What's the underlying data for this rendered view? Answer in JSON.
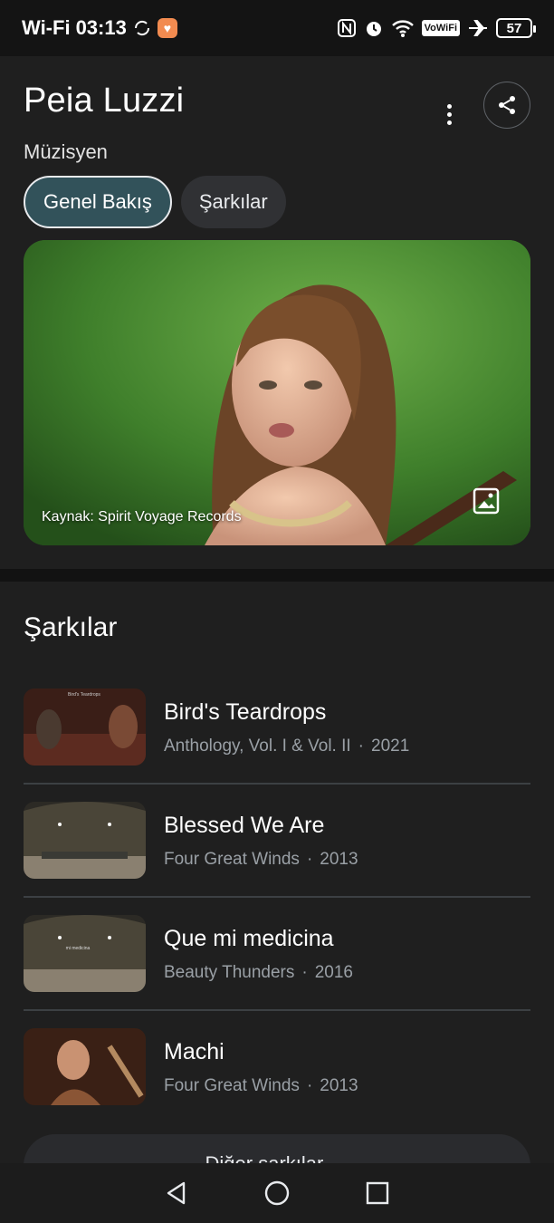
{
  "status_bar": {
    "carrier": "Wi-Fi",
    "time": "03:13",
    "battery": "57",
    "vowifi": "VoWiFi"
  },
  "header": {
    "title": "Peia Luzzi",
    "subtitle": "Müzisyen"
  },
  "tabs": [
    {
      "label": "Genel Bakış",
      "active": true
    },
    {
      "label": "Şarkılar",
      "active": false
    }
  ],
  "hero": {
    "caption": "Kaynak: Spirit Voyage Records"
  },
  "songs_section": {
    "title": "Şarkılar",
    "songs": [
      {
        "title": "Bird's Teardrops",
        "album": "Anthology, Vol. I & Vol. II",
        "year": "2021",
        "thumb_text": "Bird's Teardrops"
      },
      {
        "title": "Blessed We Are",
        "album": "Four Great Winds",
        "year": "2013"
      },
      {
        "title": "Que mi medicina",
        "album": "Beauty Thunders",
        "year": "2016",
        "thumb_text": "mi medicina"
      },
      {
        "title": "Machi",
        "album": "Four Great Winds",
        "year": "2013"
      }
    ],
    "more_label": "Diğer şarkılar →"
  },
  "icons": {
    "menu": "more-vert-icon",
    "share": "share-icon",
    "image": "image-icon",
    "nav_back": "triangle-back-icon",
    "nav_home": "circle-home-icon",
    "nav_recents": "square-recents-icon"
  },
  "colors": {
    "background": "#1f1f1f",
    "active_chip": "#32525a",
    "secondary_text": "#9aa0a6"
  }
}
